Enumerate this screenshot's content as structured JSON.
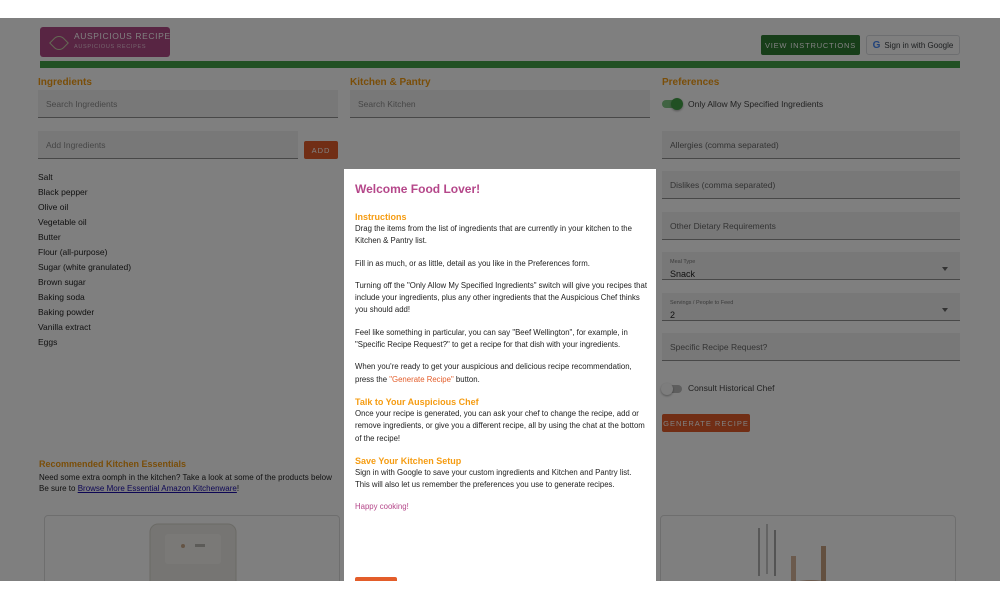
{
  "header": {
    "logo_title": "AUSPICIOUS RECIPES",
    "logo_subtitle": "AUSPICIOUS RECIPES",
    "view_instructions_label": "VIEW INSTRUCTIONS",
    "google_signin_label": "Sign in with Google"
  },
  "ingredients": {
    "heading": "Ingredients",
    "search_placeholder": "Search Ingredients",
    "add_placeholder": "Add Ingredients",
    "add_button": "ADD",
    "items": [
      "Salt",
      "Black pepper",
      "Olive oil",
      "Vegetable oil",
      "Butter",
      "Flour (all-purpose)",
      "Sugar (white granulated)",
      "Brown sugar",
      "Baking soda",
      "Baking powder",
      "Vanilla extract",
      "Eggs"
    ]
  },
  "kitchen": {
    "heading": "Kitchen & Pantry",
    "search_placeholder": "Search Kitchen"
  },
  "preferences": {
    "heading": "Preferences",
    "only_allow_label": "Only Allow My Specified Ingredients",
    "allergies_placeholder": "Allergies (comma separated)",
    "dislikes_placeholder": "Dislikes (comma separated)",
    "other_placeholder": "Other Dietary Requirements",
    "meal_type_label": "Meal Type",
    "meal_type_value": "Snack",
    "servings_label": "Servings / People to Feed",
    "servings_value": "2",
    "specific_placeholder": "Specific Recipe Request?",
    "historical_label": "Consult Historical Chef",
    "generate_button": "GENERATE RECIPE"
  },
  "recommended": {
    "heading": "Recommended Kitchen Essentials",
    "line1": "Need some extra oomph in the kitchen? Take a look at some of the products below",
    "line2_prefix": "Be sure to ",
    "link_text": "Browse More Essential Amazon Kitchenware",
    "line2_suffix": "!"
  },
  "modal": {
    "title": "Welcome Food Lover!",
    "instructions_heading": "Instructions",
    "instr_p1": "Drag the items from the list of ingredients that are currently in your kitchen to the Kitchen & Pantry list.",
    "instr_p2": "Fill in as much, or as little, detail as you like in the Preferences form.",
    "instr_p3": "Turning off the \"Only Allow My Specified Ingredients\" switch will give you recipes that include your ingredients, plus any other ingredients that the Auspicious Chef thinks you should add!",
    "instr_p4": "Feel like something in particular, you can say \"Beef Wellington\", for example, in \"Specific Recipe Request?\" to get a recipe for that dish with your ingredients.",
    "instr_p5_prefix": "When you're ready to get your auspicious and delicious recipe recommendation, press the ",
    "instr_p5_highlight": "\"Generate Recipe\"",
    "instr_p5_suffix": " button.",
    "talk_heading": "Talk to Your Auspicious Chef",
    "talk_p": "Once your recipe is generated, you can ask your chef to change the recipe, add or remove ingredients, or give you a different recipe, all by using the chat at the bottom of the recipe!",
    "save_heading": "Save Your Kitchen Setup",
    "save_p": "Sign in with Google to save your custom ingredients and Kitchen and Pantry list. This will also let us remember the preferences you use to generate recipes.",
    "happy": "Happy cooking!"
  },
  "colors": {
    "brand_pink": "#b04b86",
    "accent_orange": "#f59c12",
    "button_orange": "#e35d2a",
    "green": "#43a047"
  }
}
